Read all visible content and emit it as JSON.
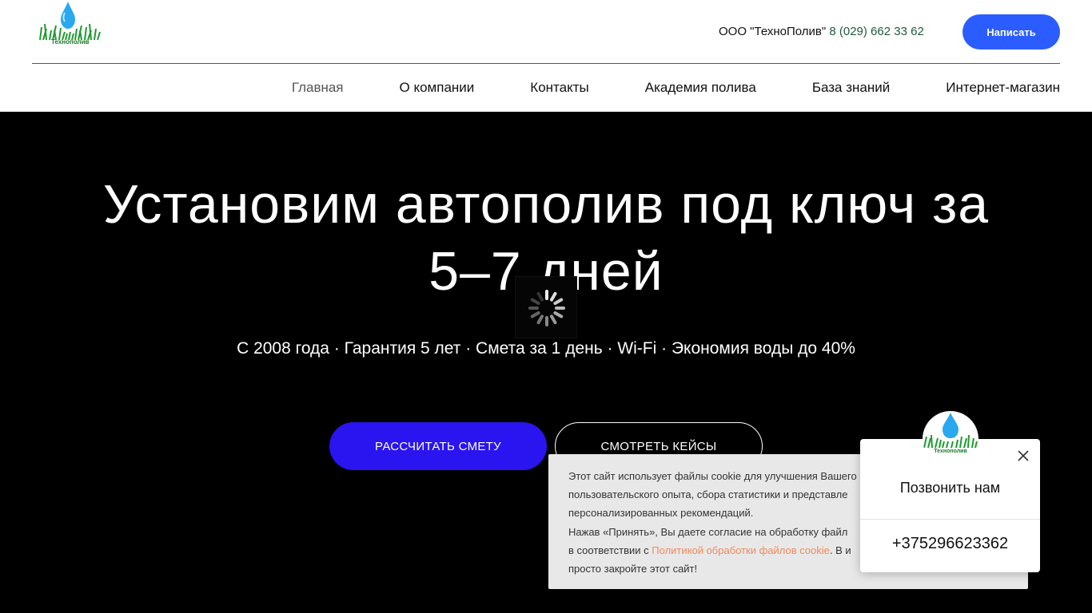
{
  "header": {
    "logo_text": "Технополив",
    "company_name": "ООО \"ТехноПолив\"",
    "phone": "8 (029) 662 33 62",
    "write_button": "Написать"
  },
  "nav": [
    {
      "label": "Главная",
      "active": true
    },
    {
      "label": "О компании"
    },
    {
      "label": "Контакты"
    },
    {
      "label": "Академия полива"
    },
    {
      "label": "База знаний"
    },
    {
      "label": "Интернет-магазин"
    }
  ],
  "hero": {
    "title_line1": "Установим автополив под ключ за",
    "title_line2": "5–7 дней",
    "subtitle": "С 2008 года · Гарантия 5 лет · Смета за 1 день · Wi-Fi · Экономия воды до 40%",
    "primary_button": "РАССЧИТАТЬ СМЕТУ",
    "secondary_button": "СМОТРЕТЬ КЕЙСЫ"
  },
  "cookie": {
    "line1": "Этот сайт использует файлы cookie для улучшения Вашего",
    "line2": "пользовательского опыта, сбора статистики и представле",
    "line3": "персонализированных рекомендаций.",
    "line4": "Нажав «Принять», Вы даете согласие на обработку файл",
    "line5_pre": "в соответствии с ",
    "line5_link": "Политикой обработки файлов cookie",
    "line5_post": ". В и",
    "line6": "просто закройте этот сайт!"
  },
  "call_widget": {
    "logo_text": "Технополив",
    "title": "Позвонить нам",
    "phone": "+375296623362"
  },
  "colors": {
    "accent": "#2a5cff",
    "primary_button": "#2a14f0",
    "link": "#f08a5d",
    "green": "#1a7a2a"
  }
}
